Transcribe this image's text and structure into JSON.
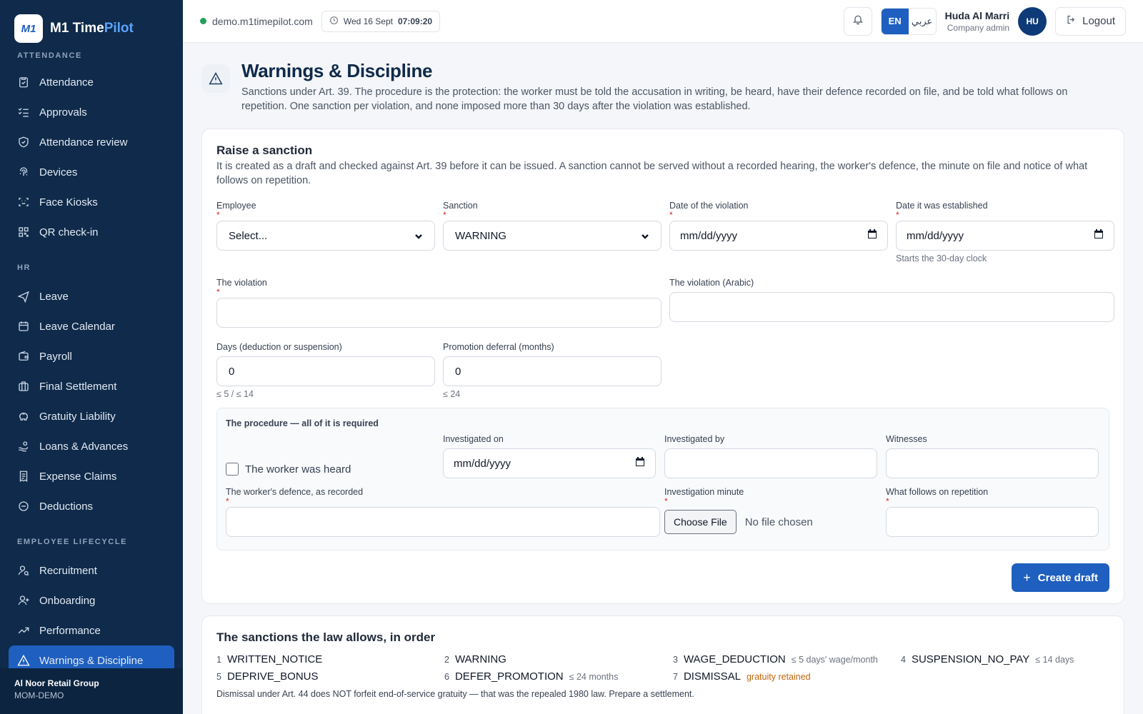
{
  "brand": {
    "logo_text": "M1",
    "name_main": "M1 Time",
    "name_accent": "Pilot"
  },
  "sidebar": {
    "sections": {
      "attendance": "ATTENDANCE",
      "hr": "HR",
      "lifecycle": "EMPLOYEE LIFECYCLE"
    },
    "attendance_items": [
      {
        "label": "Attendance",
        "icon": "clipboard-check-icon"
      },
      {
        "label": "Approvals",
        "icon": "list-check-icon"
      },
      {
        "label": "Attendance review",
        "icon": "shield-check-icon"
      },
      {
        "label": "Devices",
        "icon": "fingerprint-icon"
      },
      {
        "label": "Face Kiosks",
        "icon": "face-scan-icon"
      },
      {
        "label": "QR check-in",
        "icon": "qr-code-icon"
      }
    ],
    "hr_items": [
      {
        "label": "Leave",
        "icon": "plane-icon"
      },
      {
        "label": "Leave Calendar",
        "icon": "calendar-icon"
      },
      {
        "label": "Payroll",
        "icon": "wallet-icon"
      },
      {
        "label": "Final Settlement",
        "icon": "briefcase-icon"
      },
      {
        "label": "Gratuity Liability",
        "icon": "piggy-bank-icon"
      },
      {
        "label": "Loans & Advances",
        "icon": "hand-coins-icon"
      },
      {
        "label": "Expense Claims",
        "icon": "receipt-icon"
      },
      {
        "label": "Deductions",
        "icon": "minus-circle-icon"
      }
    ],
    "lifecycle_items": [
      {
        "label": "Recruitment",
        "icon": "user-search-icon"
      },
      {
        "label": "Onboarding",
        "icon": "user-plus-icon"
      },
      {
        "label": "Performance",
        "icon": "trending-up-icon"
      },
      {
        "label": "Warnings & Discipline",
        "icon": "warning-triangle-icon",
        "active": true
      }
    ],
    "footer": {
      "org": "Al Noor Retail Group",
      "code": "MOM-DEMO"
    }
  },
  "topbar": {
    "domain": "demo.m1timepilot.com",
    "date": "Wed 16 Sept",
    "time": "07:09:20",
    "lang_en": "EN",
    "lang_ar": "عربي",
    "user_name": "Huda Al Marri",
    "user_role": "Company admin",
    "avatar": "HU",
    "logout": "Logout"
  },
  "page": {
    "title": "Warnings & Discipline",
    "subtitle": "Sanctions under Art. 39. The procedure is the protection: the worker must be told the accusation in writing, be heard, have their defence recorded on file, and be told what follows on repetition. One sanction per violation, and none imposed more than 30 days after the violation was established."
  },
  "form": {
    "title": "Raise a sanction",
    "description": "It is created as a draft and checked against Art. 39 before it can be issued. A sanction cannot be served without a recorded hearing, the worker's defence, the minute on file and notice of what follows on repetition.",
    "employee": {
      "label": "Employee",
      "value": "Select..."
    },
    "sanction": {
      "label": "Sanction",
      "value": "WARNING"
    },
    "violation_date": {
      "label": "Date of the violation",
      "value": "mm/dd/yyyy"
    },
    "established_date": {
      "label": "Date it was established",
      "value": "mm/dd/yyyy",
      "hint": "Starts the 30-day clock"
    },
    "violation": {
      "label": "The violation",
      "value": ""
    },
    "violation_ar": {
      "label": "The violation (Arabic)",
      "value": ""
    },
    "days": {
      "label": "Days (deduction or suspension)",
      "value": "0",
      "hint": "≤ 5 / ≤ 14"
    },
    "deferral": {
      "label": "Promotion deferral (months)",
      "value": "0",
      "hint": "≤ 24"
    },
    "required_mark": "*",
    "procedure": {
      "title": "The procedure — all of it is required",
      "heard_label": "The worker was heard",
      "heard_checked": false,
      "investigated_on": {
        "label": "Investigated on",
        "value": "mm/dd/yyyy"
      },
      "investigated_by": {
        "label": "Investigated by",
        "value": ""
      },
      "witnesses": {
        "label": "Witnesses",
        "value": ""
      },
      "defence": {
        "label": "The worker's defence, as recorded",
        "value": ""
      },
      "minute": {
        "label": "Investigation minute",
        "button": "Choose File",
        "status": "No file chosen"
      },
      "repetition": {
        "label": "What follows on repetition",
        "value": ""
      }
    },
    "submit": "Create draft"
  },
  "law": {
    "title": "The sanctions the law allows, in order",
    "items": [
      {
        "num": "1",
        "code": "WRITTEN_NOTICE",
        "note": ""
      },
      {
        "num": "2",
        "code": "WARNING",
        "note": ""
      },
      {
        "num": "3",
        "code": "WAGE_DEDUCTION",
        "note": "≤ 5 days' wage/month"
      },
      {
        "num": "4",
        "code": "SUSPENSION_NO_PAY",
        "note": "≤ 14 days"
      },
      {
        "num": "5",
        "code": "DEPRIVE_BONUS",
        "note": ""
      },
      {
        "num": "6",
        "code": "DEFER_PROMOTION",
        "note": "≤ 24 months"
      },
      {
        "num": "7",
        "code": "DISMISSAL",
        "note": "gratuity retained"
      }
    ],
    "footnote": "Dismissal under Art. 44 does NOT forfeit end-of-service gratuity — that was the repealed 1980 law. Prepare a settlement."
  },
  "colors": {
    "sidebar": "#0f2a4a",
    "accent": "#1e5fbf",
    "required": "#dc2626",
    "status_green": "#22a05b",
    "note_orange": "#c2650a"
  }
}
